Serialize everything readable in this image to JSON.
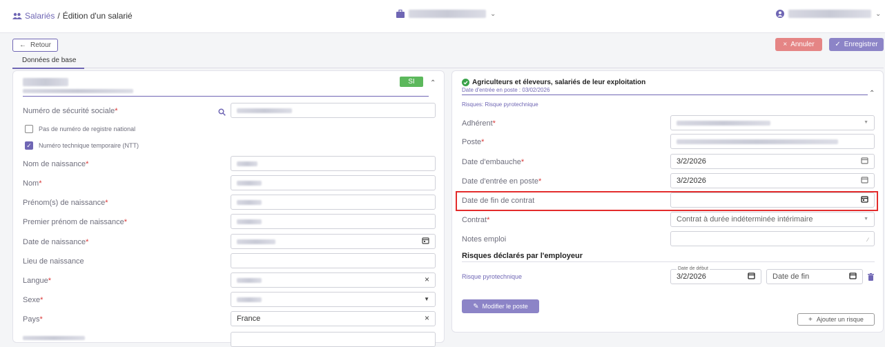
{
  "header": {
    "breadcrumb_link": "Salariés",
    "breadcrumb_sep": "/",
    "breadcrumb_current": "Édition d'un salarié"
  },
  "toolbar": {
    "back_label": "Retour",
    "cancel_label": "Annuler",
    "save_label": "Enregistrer"
  },
  "tabs": {
    "base_label": "Données de base"
  },
  "left": {
    "si_badge": "SI",
    "nss_label": "Numéro de sécurité sociale",
    "no_registry_label": "Pas de numéro de registre national",
    "ntt_label": "Numéro technique temporaire (NTT)",
    "birth_name_label": "Nom de naissance",
    "name_label": "Nom",
    "birth_firstnames_label": "Prénom(s) de naissance",
    "first_firstname_label": "Premier prénom de naissance",
    "birth_date_label": "Date de naissance",
    "birth_place_label": "Lieu de naissance",
    "language_label": "Langue",
    "sex_label": "Sexe",
    "country_label": "Pays",
    "country_value": "France"
  },
  "right": {
    "job_title": "Agriculteurs et éleveurs, salariés de leur exploitation",
    "entry_date_text": "Date d'entrée en poste : 03/02/2026",
    "risks_text": "Risques:  Risque pyrotechnique",
    "member_label": "Adhérent",
    "post_label": "Poste",
    "hire_date_label": "Date d'embauche",
    "hire_date_value": "3/2/2026",
    "entry_date_label": "Date d'entrée en poste",
    "entry_date_value": "3/2/2026",
    "contract_end_label": "Date de fin de contrat",
    "contract_label": "Contrat",
    "contract_value": "Contrat à durée indéterminée intérimaire",
    "job_notes_label": "Notes emploi",
    "declared_risks_title": "Risques déclarés par l'employeur",
    "risk_name": "Risque pyrotechnique",
    "start_date_legend": "Date de début",
    "start_date_value": "3/2/2026",
    "end_date_placeholder": "Date de fin",
    "modify_post_label": "Modifier le poste",
    "add_risk_label": "Ajouter un risque"
  },
  "colors": {
    "accent": "#6f66b4",
    "danger": "#e58585",
    "success": "#5cb85c",
    "highlight_border": "#e32b2b"
  }
}
